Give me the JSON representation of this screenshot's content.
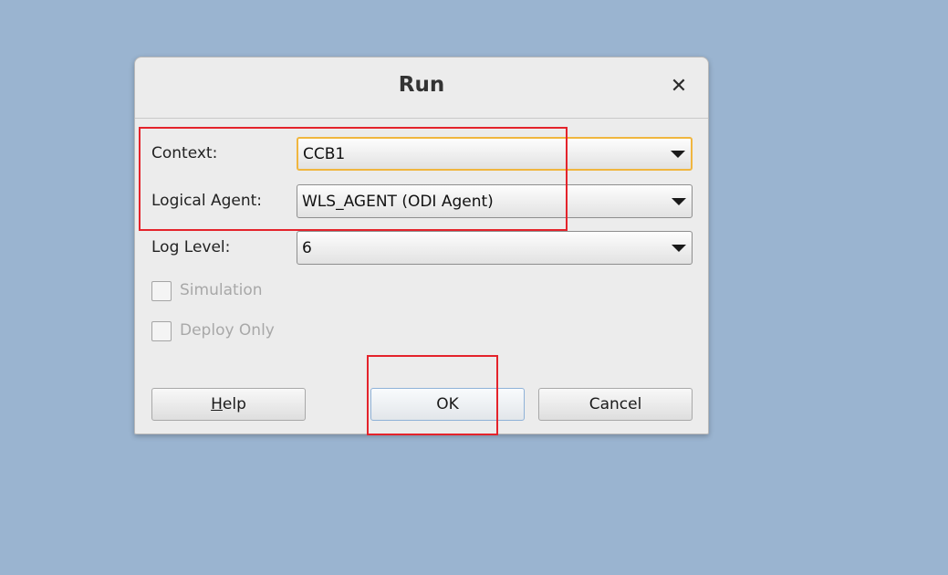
{
  "dialog": {
    "title": "Run",
    "close_glyph": "✕"
  },
  "form": {
    "context_label": "Context:",
    "context_value": "CCB1",
    "agent_label": "Logical Agent:",
    "agent_value": "WLS_AGENT (ODI Agent)",
    "log_label": "Log Level:",
    "log_value": "6",
    "simulation_label": "Simulation",
    "simulation_checked": false,
    "deploy_label": "Deploy Only",
    "deploy_checked": false
  },
  "buttons": {
    "help_mnemonic": "H",
    "help_rest": "elp",
    "ok_label": "OK",
    "cancel_label": "Cancel"
  },
  "colors": {
    "desktop": "#9ab4d0",
    "annotation": "#e4232b",
    "focus": "#f0b63f"
  }
}
